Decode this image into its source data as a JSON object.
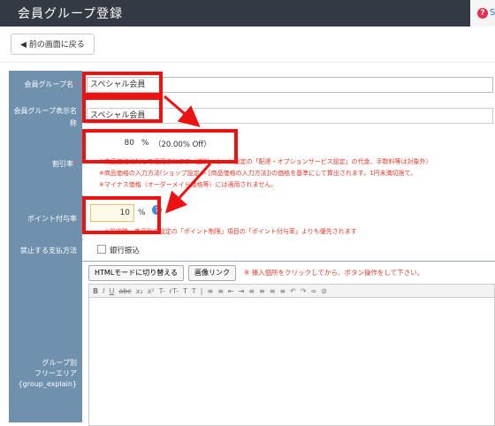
{
  "header": {
    "title": "会員グループ登録",
    "help_link": "S"
  },
  "back_button": {
    "label": "前の画面に戻る"
  },
  "fields": {
    "group_name": {
      "label": "会員グループ名",
      "required_mark": "*",
      "value": "スペシャル会員"
    },
    "display_name": {
      "label": "会員グループ表示名称",
      "value": "スペシャル会員"
    },
    "discount_rate": {
      "label": "割引率",
      "required_mark": "*",
      "value": "80",
      "unit": "%",
      "off_text": "（20.00% Off）",
      "notes": [
        "※商品価格に対して適用されます（送料・カート設定の「配達・オプションサービス設定」の代金、手数料等は対象外）",
        "※商品価格の入力方法(ショップ設定 > [商品価格の入力方法])の価格を基準にして算出されます。1円未満切捨て。",
        "※マイナス価格（オーダーメイド価格等）には適用されません。"
      ]
    },
    "point_rate": {
      "label": "ポイント付与率",
      "value": "10",
      "unit": "%",
      "note": "※設定時、商品別の設定の「ポイント制限」項目の「ポイント付与率」よりも優先されます"
    },
    "prohibited_payment": {
      "label": "禁止する支払方法",
      "option": "銀行振込"
    },
    "free_area": {
      "label_lines": [
        "グループ別",
        "フリーエリア",
        "{group_explain}"
      ],
      "html_mode_button": "HTMLモードに切り替える",
      "image_link_button": "画像リンク",
      "hint": "※ 挿入個所をクリックしてから、ボタン操作をして下さい。",
      "toolbar": [
        "B",
        "I",
        "U",
        "abc",
        "x₂",
        "x²",
        "T-",
        "rT-",
        "T",
        "T",
        "|",
        "≡",
        "≡",
        "⇤",
        "⇥",
        "≡",
        "≡",
        "≡",
        "≡",
        "↶",
        "↷",
        "∞",
        "⊘"
      ]
    }
  },
  "colors": {
    "label_bg": "#6f91ae",
    "annotation": "#ee1111",
    "note_red": "#e03a2a",
    "header_bg": "#333a43"
  }
}
